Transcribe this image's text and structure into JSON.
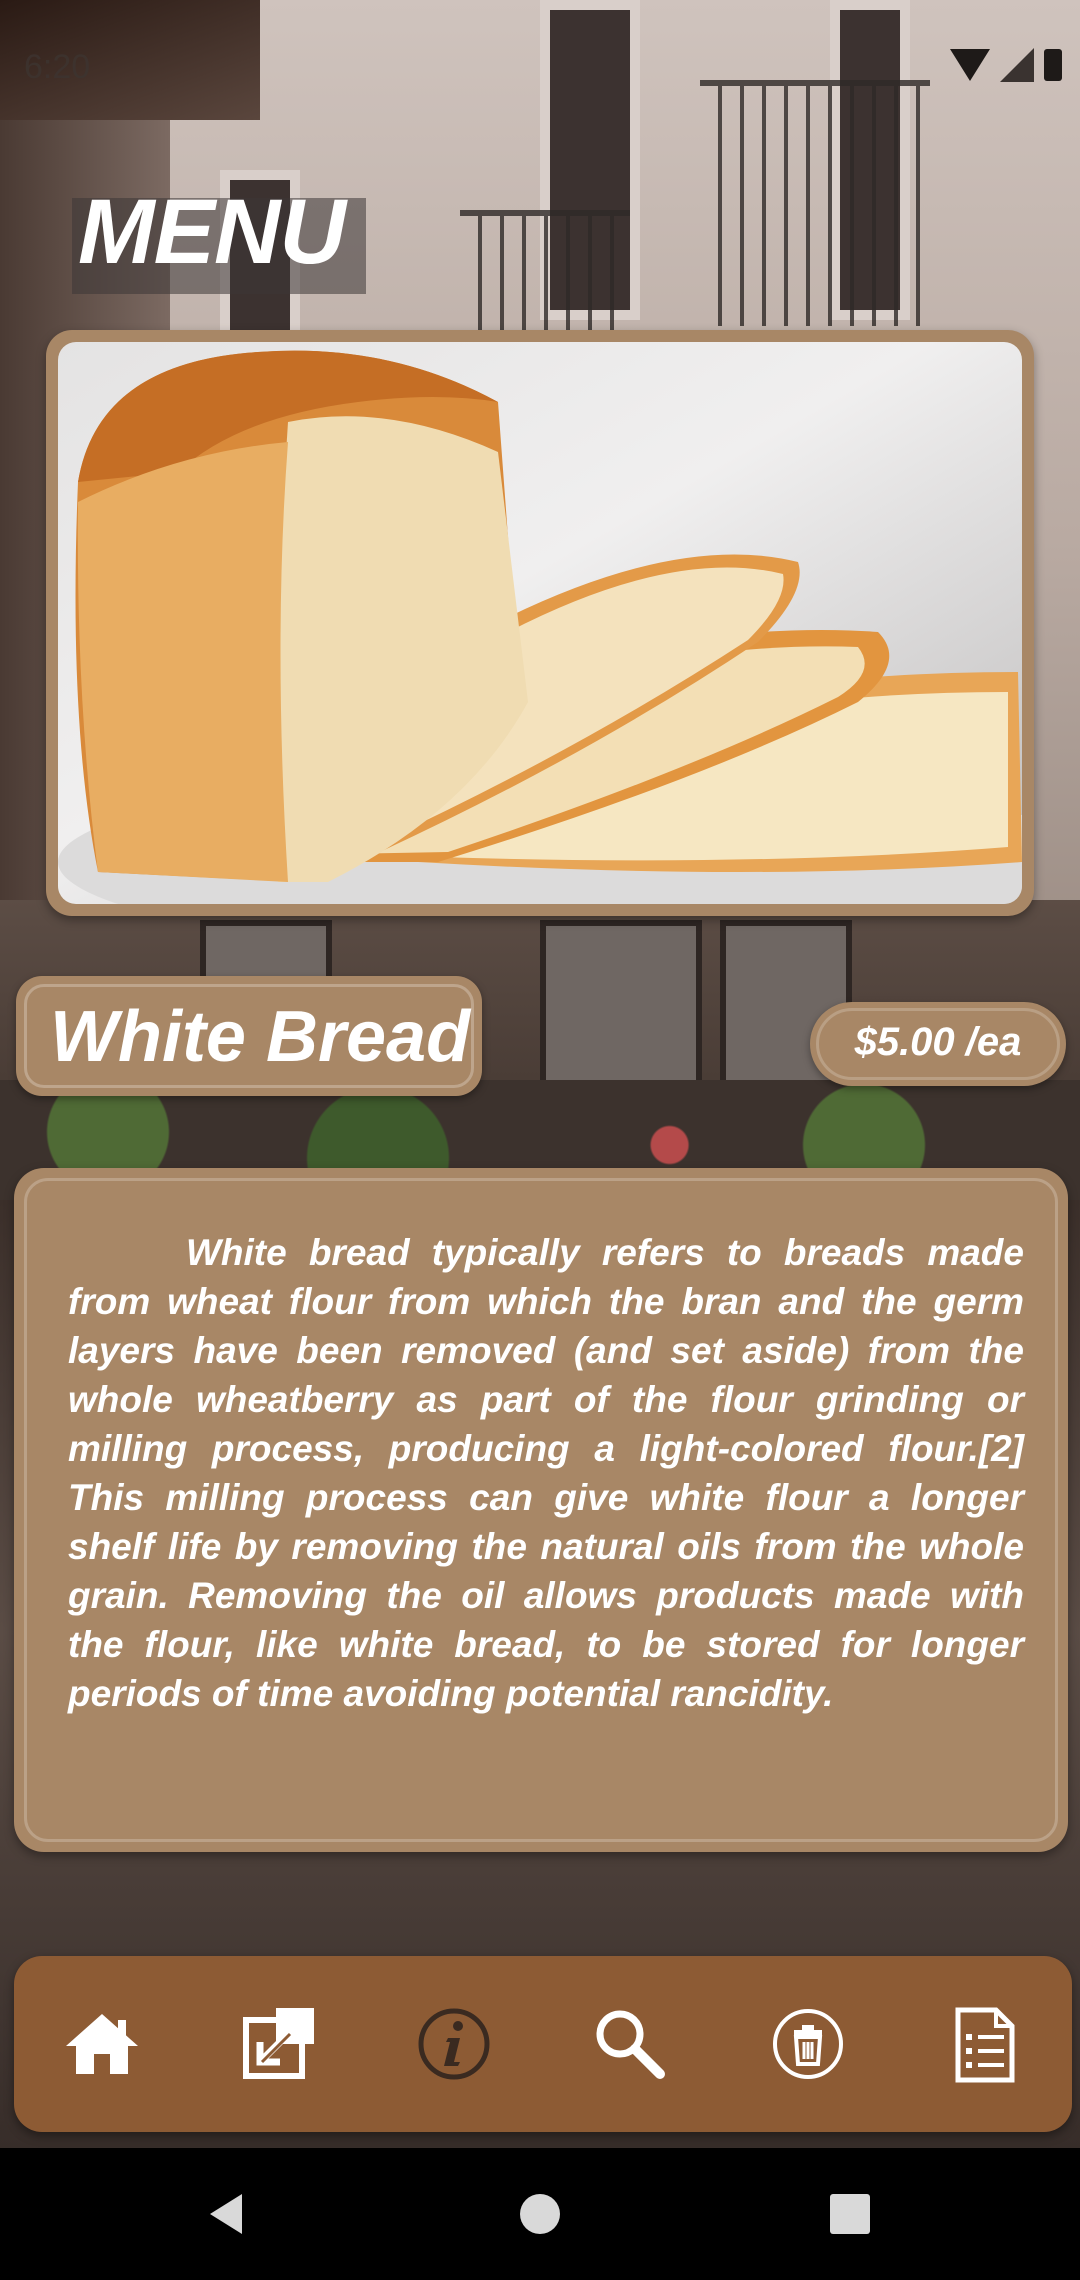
{
  "status_bar": {
    "time": "6:20"
  },
  "header": {
    "title": "MENU"
  },
  "item": {
    "name": "White Bread",
    "price": "$5.00 /ea",
    "description": "White bread typically refers to breads made from wheat flour from which the bran and the germ layers have been removed (and set aside) from the whole wheatberry as part of the flour grinding or milling process, producing a light-colored flour.[2] This milling process can give white flour a longer shelf life by removing the natural oils from the whole grain. Removing the oil allows products made with the flour, like white bread, to be stored for longer periods of time avoiding potential rancidity."
  },
  "toolbar": {
    "icons": [
      "home-icon",
      "external-link-icon",
      "info-icon",
      "search-icon",
      "delete-icon",
      "list-icon"
    ]
  },
  "colors": {
    "card": "#a88766",
    "toolbar": "#8d5b34",
    "text": "#ffffff"
  },
  "navigation": {
    "icons": [
      "back-icon",
      "home-circle-icon",
      "recents-icon"
    ]
  }
}
